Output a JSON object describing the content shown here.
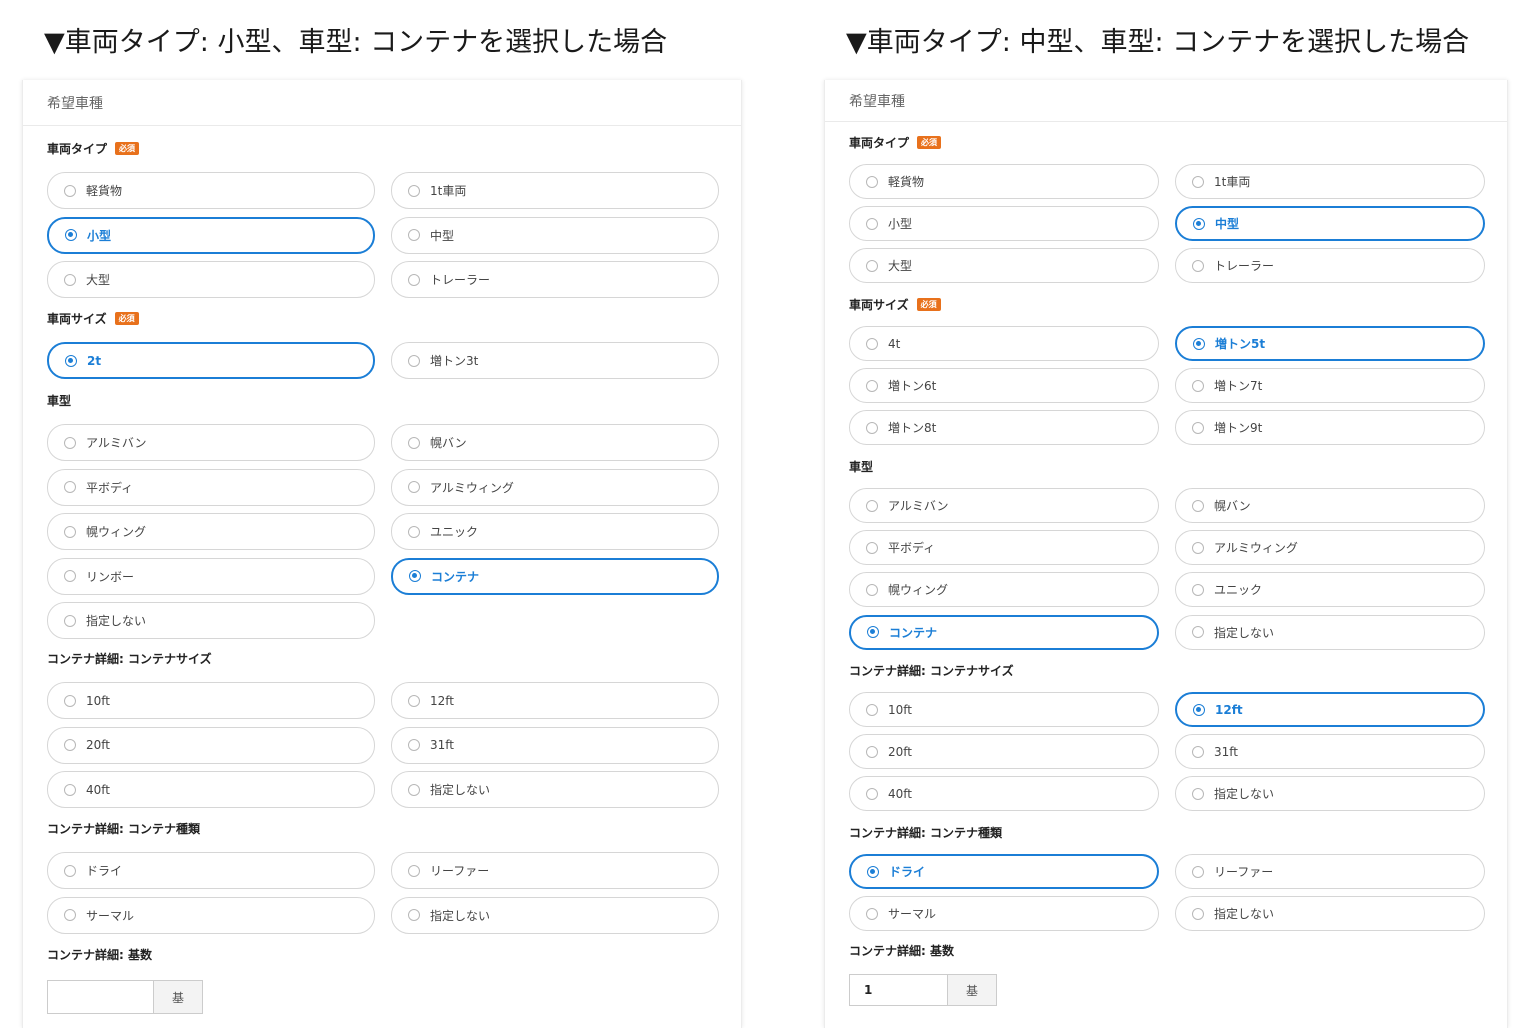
{
  "captions": {
    "left": "▼車両タイプ: 小型、車型: コンテナを選択した場合",
    "right": "▼車両タイプ: 中型、車型: コンテナを選択した場合"
  },
  "required_badge": "必須",
  "colors": {
    "accent": "#1b7ed6",
    "required": "#e8711c",
    "border": "#d6d6d6"
  },
  "left": {
    "title": "希望車種",
    "vehicle_type": {
      "label": "車両タイプ",
      "options": [
        "軽貨物",
        "1t車両",
        "小型",
        "中型",
        "大型",
        "トレーラー"
      ],
      "selected": "小型"
    },
    "vehicle_size": {
      "label": "車両サイズ",
      "options": [
        "2t",
        "増トン3t"
      ],
      "selected": "2t"
    },
    "body_type": {
      "label": "車型",
      "options": [
        "アルミバン",
        "幌バン",
        "平ボディ",
        "アルミウィング",
        "幌ウィング",
        "ユニック",
        "リンボー",
        "コンテナ",
        "指定しない"
      ],
      "selected": "コンテナ"
    },
    "container_size": {
      "label": "コンテナ詳細: コンテナサイズ",
      "options": [
        "10ft",
        "12ft",
        "20ft",
        "31ft",
        "40ft",
        "指定しない"
      ],
      "selected": ""
    },
    "container_kind": {
      "label": "コンテナ詳細: コンテナ種類",
      "options": [
        "ドライ",
        "リーファー",
        "サーマル",
        "指定しない"
      ],
      "selected": ""
    },
    "container_count": {
      "label": "コンテナ詳細: 基数",
      "value": "",
      "unit": "基"
    }
  },
  "right": {
    "title": "希望車種",
    "vehicle_type": {
      "label": "車両タイプ",
      "options": [
        "軽貨物",
        "1t車両",
        "小型",
        "中型",
        "大型",
        "トレーラー"
      ],
      "selected": "中型"
    },
    "vehicle_size": {
      "label": "車両サイズ",
      "options": [
        "4t",
        "増トン5t",
        "増トン6t",
        "増トン7t",
        "増トン8t",
        "増トン9t"
      ],
      "selected": "増トン5t"
    },
    "body_type": {
      "label": "車型",
      "options": [
        "アルミバン",
        "幌バン",
        "平ボディ",
        "アルミウィング",
        "幌ウィング",
        "ユニック",
        "コンテナ",
        "指定しない"
      ],
      "selected": "コンテナ"
    },
    "container_size": {
      "label": "コンテナ詳細: コンテナサイズ",
      "options": [
        "10ft",
        "12ft",
        "20ft",
        "31ft",
        "40ft",
        "指定しない"
      ],
      "selected": "12ft"
    },
    "container_kind": {
      "label": "コンテナ詳細: コンテナ種類",
      "options": [
        "ドライ",
        "リーファー",
        "サーマル",
        "指定しない"
      ],
      "selected": "ドライ"
    },
    "container_count": {
      "label": "コンテナ詳細: 基数",
      "value": "1",
      "unit": "基"
    }
  }
}
